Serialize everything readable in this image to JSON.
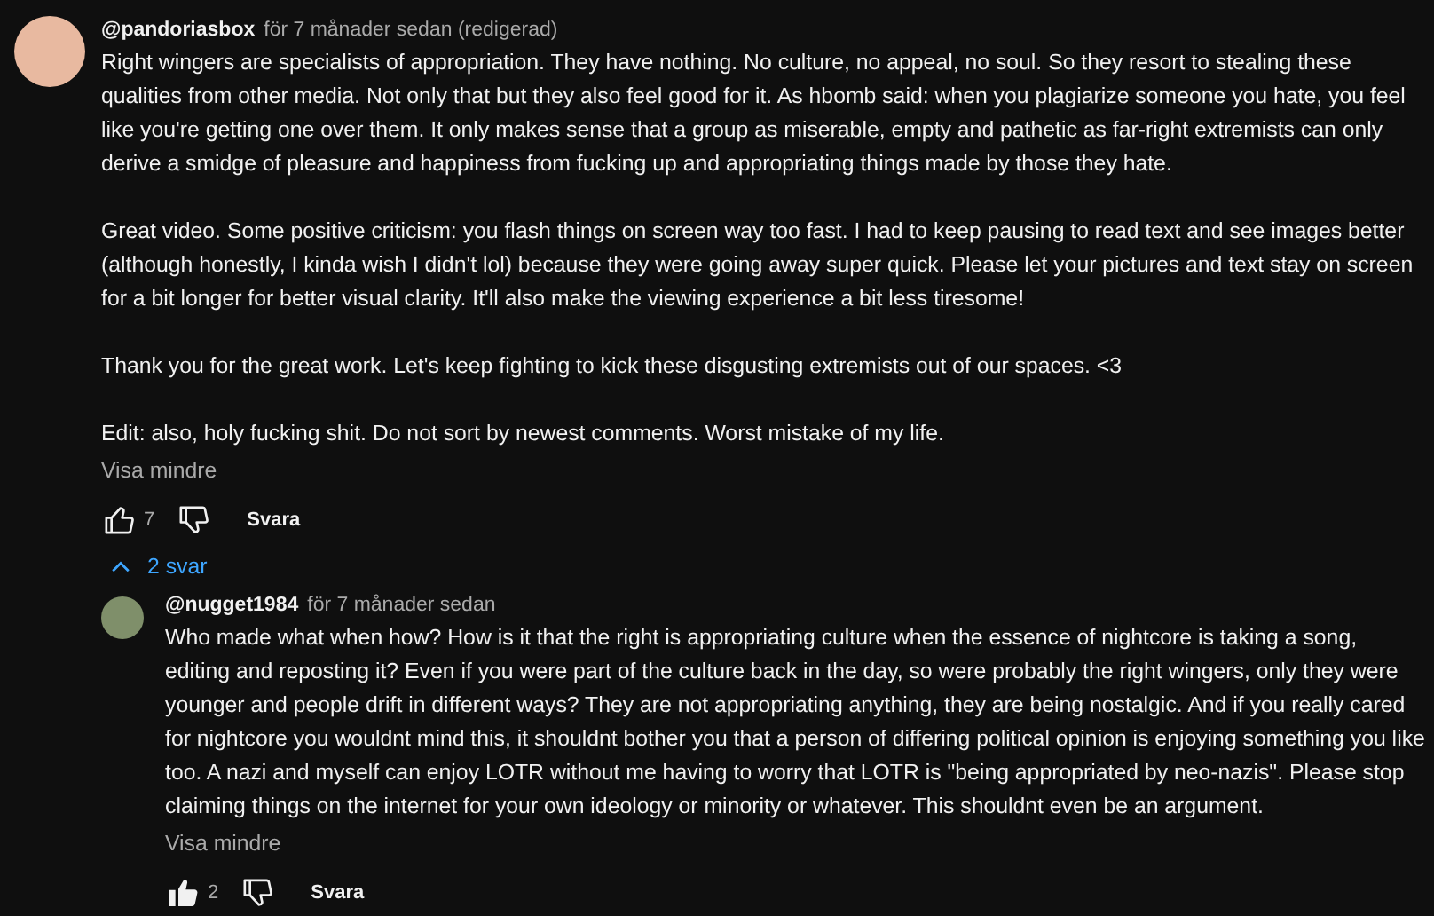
{
  "comment": {
    "author": "@pandoriasbox",
    "time": "för 7 månader sedan (redigerad)",
    "paragraphs": [
      "Right wingers are specialists of appropriation. They have nothing. No culture, no appeal, no soul. So they resort to stealing these qualities from other media. Not only that but they also feel good for it. As hbomb said: when you plagiarize someone you hate, you feel like you're getting one over them. It only makes sense that a group as miserable, empty and pathetic as far-right extremists can only derive a smidge of pleasure and happiness from fucking up and appropriating things made by those they hate.",
      "Great video. Some positive criticism: you flash things on screen way too fast. I had to keep pausing to read text and see images better (although honestly, I kinda wish I didn't lol) because they were going away super quick. Please let your pictures and text stay on screen for a bit longer for better visual clarity. It'll also make the viewing experience a bit less tiresome!",
      "Thank you for the great work. Let's keep fighting to kick these disgusting extremists out of our spaces. <3",
      "Edit: also, holy fucking shit. Do not sort by newest comments. Worst mistake of my life."
    ],
    "show_less": "Visa mindre",
    "likes": "7",
    "liked": false,
    "reply_label": "Svara",
    "replies_toggle": {
      "label": "2 svar",
      "expanded": true
    },
    "replies": [
      {
        "author": "@nugget1984",
        "time": "för 7 månader sedan",
        "paragraphs": [
          "Who made what when how? How is it that the right is appropriating culture when the essence of nightcore is taking a song, editing and reposting it? Even if you were part of the culture back in the day, so were probably the right wingers, only they were younger and people drift in different ways? They are not appropriating anything, they are being nostalgic. And if you really cared for nightcore you wouldnt mind this, it shouldnt bother you that a person of differing political opinion is enjoying something you like too. A nazi and myself can enjoy LOTR without me having to worry that LOTR is \"being appropriated by neo-nazis\". Please stop claiming things on the internet for your own ideology or minority or whatever. This shouldnt even be an argument."
        ],
        "show_less": "Visa mindre",
        "likes": "2",
        "liked": true,
        "reply_label": "Svara"
      }
    ]
  }
}
